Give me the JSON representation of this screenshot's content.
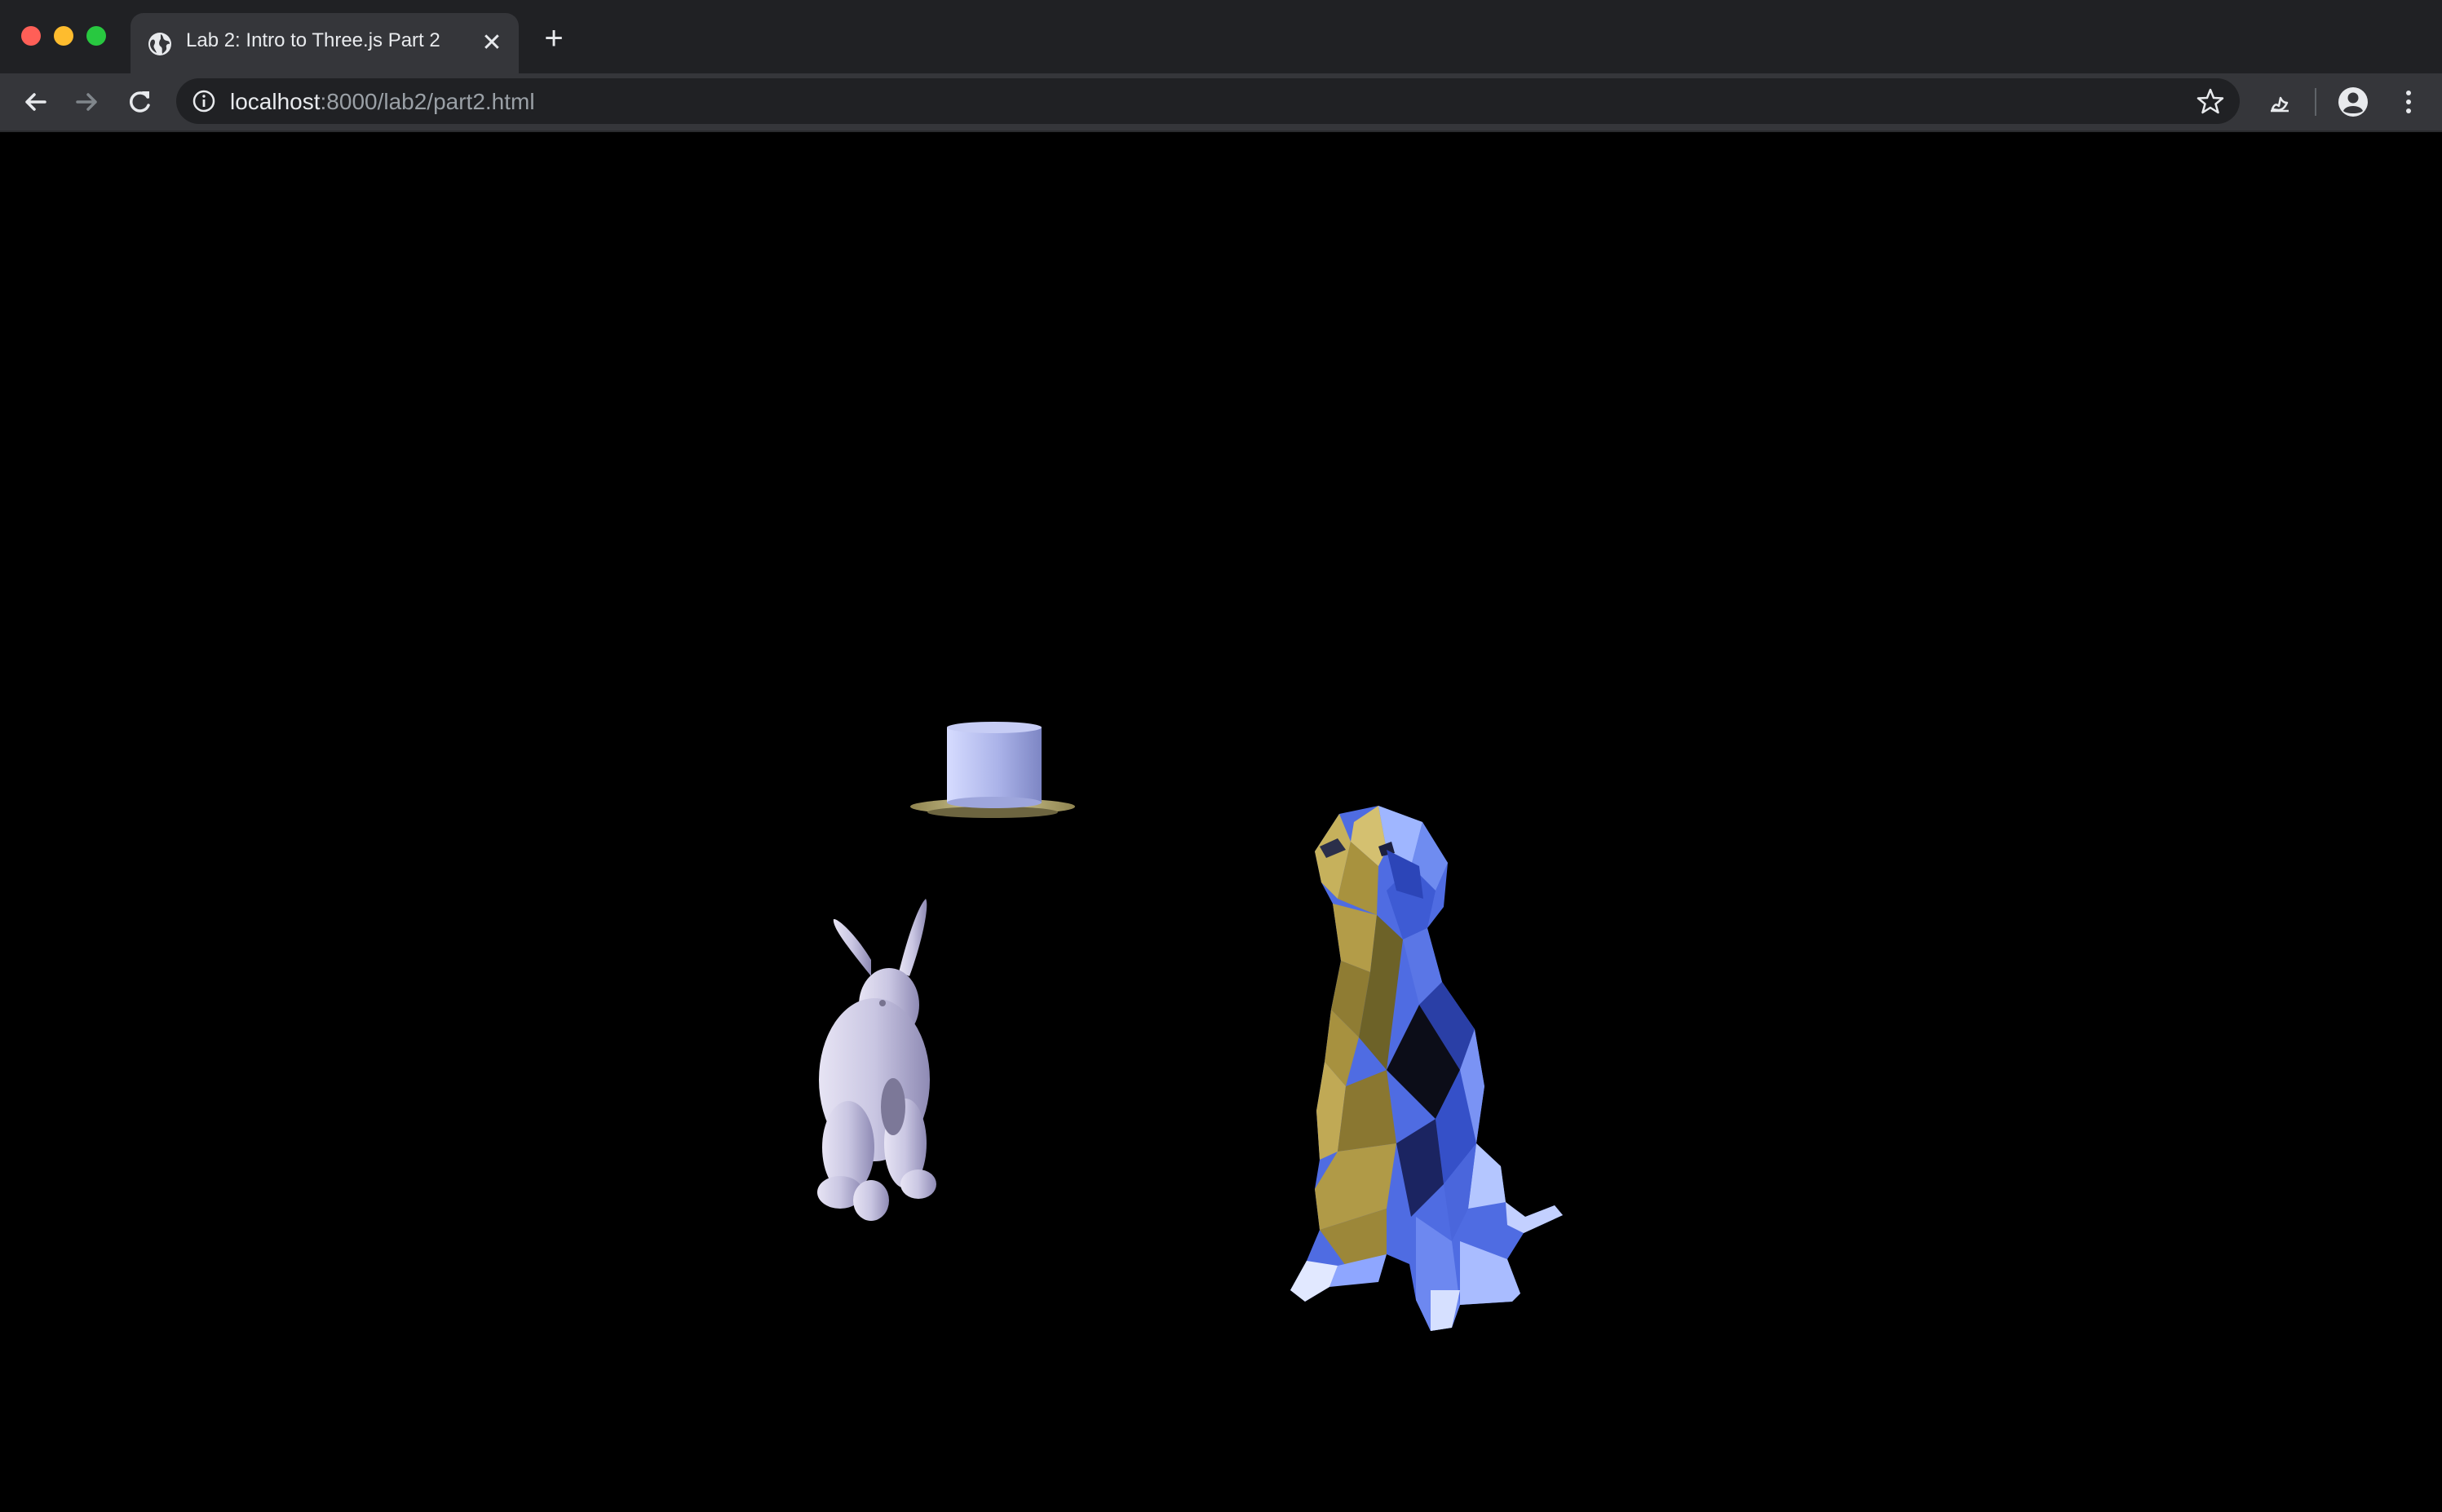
{
  "browser": {
    "tab": {
      "title": "Lab 2: Intro to Three.js Part 2",
      "favicon": "globe-icon",
      "close_icon": "close-icon"
    },
    "new_tab_icon": "plus-icon",
    "toolbar": {
      "back_icon": "arrow-left-icon",
      "forward_icon": "arrow-right-icon",
      "reload_icon": "reload-icon",
      "address": {
        "security_icon": "info-icon",
        "host": "localhost",
        "path": ":8000/lab2/part2.html"
      },
      "bookmark_icon": "star-icon",
      "extension_icon": "extension-icon",
      "profile_icon": "account-circle-icon",
      "menu_icon": "kebab-menu-icon"
    },
    "colors": {
      "tabstrip": "#202124",
      "toolbar": "#35363a",
      "traffic_close": "#ff5f57",
      "traffic_min": "#febc2e",
      "traffic_max": "#28c840"
    }
  },
  "scene": {
    "background": "#000000",
    "objects": [
      "top-hat",
      "rabbit",
      "dog"
    ]
  }
}
